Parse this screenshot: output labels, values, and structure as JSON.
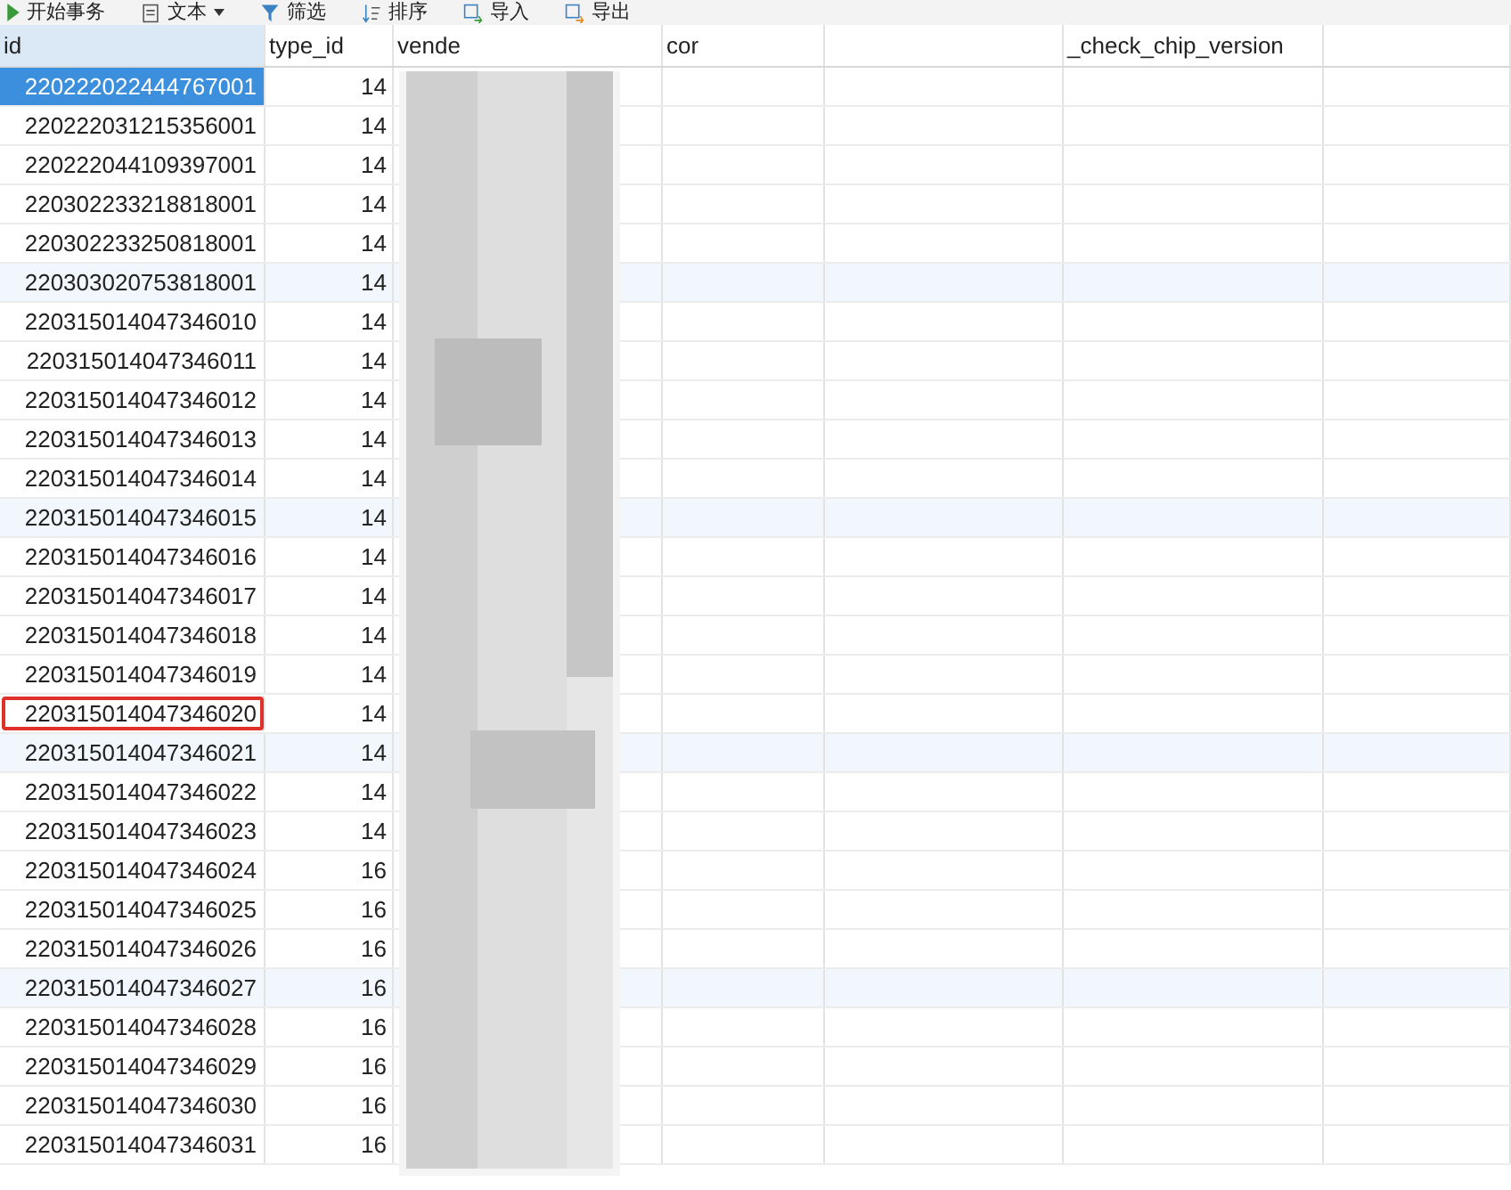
{
  "toolbar": [
    {
      "label": "开始事务",
      "dropdown": false
    },
    {
      "label": "文本",
      "dropdown": true
    },
    {
      "label": "筛选",
      "dropdown": false
    },
    {
      "label": "排序",
      "dropdown": false
    },
    {
      "label": "导入",
      "dropdown": false
    },
    {
      "label": "导出",
      "dropdown": false
    }
  ],
  "table": {
    "columns": [
      {
        "label": "id",
        "selected": true
      },
      {
        "label": "type_id",
        "selected": false
      },
      {
        "label": "vende",
        "selected": false
      },
      {
        "label": "cor",
        "selected": false
      },
      {
        "selected": false
      },
      {
        "label": "_check_chip_version",
        "selected": false
      },
      {
        "selected": false
      }
    ],
    "rows": [
      {
        "id": "220222022444767001",
        "type_id": "14",
        "selected": true,
        "marked": false
      },
      {
        "id": "220222031215356001",
        "type_id": "14",
        "selected": false,
        "marked": false
      },
      {
        "id": "220222044109397001",
        "type_id": "14",
        "selected": false,
        "marked": false
      },
      {
        "id": "220302233218818001",
        "type_id": "14",
        "selected": false,
        "marked": false
      },
      {
        "id": "220302233250818001",
        "type_id": "14",
        "selected": false,
        "marked": false
      },
      {
        "id": "220303020753818001",
        "type_id": "14",
        "selected": false,
        "marked": false
      },
      {
        "id": "220315014047346010",
        "type_id": "14",
        "selected": false,
        "marked": false
      },
      {
        "id": "220315014047346011",
        "type_id": "14",
        "selected": false,
        "marked": false
      },
      {
        "id": "220315014047346012",
        "type_id": "14",
        "selected": false,
        "marked": false
      },
      {
        "id": "220315014047346013",
        "type_id": "14",
        "selected": false,
        "marked": false
      },
      {
        "id": "220315014047346014",
        "type_id": "14",
        "selected": false,
        "marked": false
      },
      {
        "id": "220315014047346015",
        "type_id": "14",
        "selected": false,
        "marked": false
      },
      {
        "id": "220315014047346016",
        "type_id": "14",
        "selected": false,
        "marked": false
      },
      {
        "id": "220315014047346017",
        "type_id": "14",
        "selected": false,
        "marked": false
      },
      {
        "id": "220315014047346018",
        "type_id": "14",
        "selected": false,
        "marked": false
      },
      {
        "id": "220315014047346019",
        "type_id": "14",
        "selected": false,
        "marked": false
      },
      {
        "id": "220315014047346020",
        "type_id": "14",
        "selected": false,
        "marked": true
      },
      {
        "id": "220315014047346021",
        "type_id": "14",
        "selected": false,
        "marked": false
      },
      {
        "id": "220315014047346022",
        "type_id": "14",
        "selected": false,
        "marked": false
      },
      {
        "id": "220315014047346023",
        "type_id": "14",
        "selected": false,
        "marked": false
      },
      {
        "id": "220315014047346024",
        "type_id": "16",
        "selected": false,
        "marked": false
      },
      {
        "id": "220315014047346025",
        "type_id": "16",
        "selected": false,
        "marked": false
      },
      {
        "id": "220315014047346026",
        "type_id": "16",
        "selected": false,
        "marked": false
      },
      {
        "id": "220315014047346027",
        "type_id": "16",
        "selected": false,
        "marked": false
      },
      {
        "id": "220315014047346028",
        "type_id": "16",
        "selected": false,
        "marked": false
      },
      {
        "id": "220315014047346029",
        "type_id": "16",
        "selected": false,
        "marked": false
      },
      {
        "id": "220315014047346030",
        "type_id": "16",
        "selected": false,
        "marked": false
      },
      {
        "id": "220315014047346031",
        "type_id": "16",
        "selected": false,
        "marked": false
      }
    ]
  }
}
